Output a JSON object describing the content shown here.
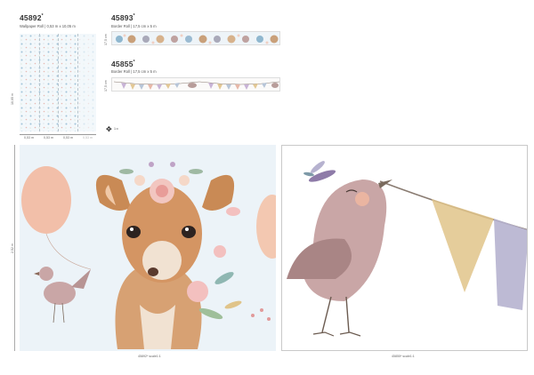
{
  "products": [
    {
      "code": "45892",
      "mark": "*",
      "description": "Wallpaper Roll | 0,53 m x 10,05 m"
    },
    {
      "code": "45893",
      "mark": "*",
      "description": "Border Roll | 17,5 cm x 5 m"
    },
    {
      "code": "45855",
      "mark": "*",
      "description": "Border Roll | 17,5 cm x 5 m"
    }
  ],
  "wallpaper_dimensions": {
    "roll_widths": [
      "0,53 m",
      "0,53 m",
      "0,53 m",
      "0,53 m"
    ],
    "height_label": "10,05 m"
  },
  "border_heights": [
    "17,5 cm",
    "17,5 cm"
  ],
  "scale": {
    "icon": "move-arrows-icon",
    "label": "1:x"
  },
  "panels": {
    "left_height": "2,52 m",
    "left_caption": "45892* scale1:1",
    "right_caption": "45855* scale1:1"
  },
  "colors": {
    "deer": "#c98a55",
    "balloon": "#f3b9a0",
    "bird": "#c9a6a6",
    "flag_gold": "#e0c48a",
    "flag_lilac": "#b6b2cf",
    "wallpaper_bg": "#f3f8fb"
  }
}
